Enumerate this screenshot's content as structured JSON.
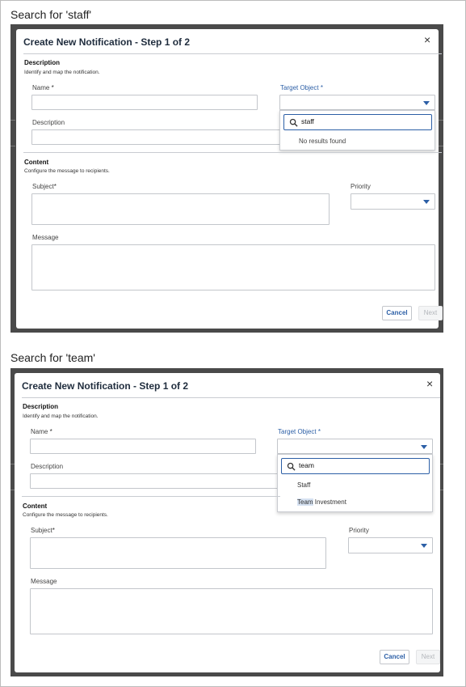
{
  "panels": [
    {
      "caption": "Search for 'staff'",
      "modal_title": "Create New Notification - Step 1 of 2",
      "close_glyph": "×",
      "description_section": {
        "title": "Description",
        "subtitle": "Identify and map the notification."
      },
      "name_label": "Name",
      "description_label": "Description",
      "target_object_label": "Target Object",
      "required_marker": "*",
      "search_value": "staff",
      "dropdown_message": "No results found",
      "content_section": {
        "title": "Content",
        "subtitle": "Configure the message to recipients."
      },
      "subject_label": "Subject",
      "priority_label": "Priority",
      "message_label": "Message",
      "cancel_label": "Cancel",
      "next_label": "Next"
    },
    {
      "caption": "Search for 'team'",
      "modal_title": "Create New Notification - Step 1 of 2",
      "close_glyph": "×",
      "description_section": {
        "title": "Description",
        "subtitle": "Identify and map the notification."
      },
      "name_label": "Name",
      "description_label": "Description",
      "target_object_label": "Target Object",
      "required_marker": "*",
      "search_value": "team",
      "dropdown_options": [
        {
          "label_highlight": "",
          "label_rest": "Staff"
        },
        {
          "label_highlight": "Team",
          "label_rest": " Investment"
        }
      ],
      "content_section": {
        "title": "Content",
        "subtitle": "Configure the message to recipients."
      },
      "subject_label": "Subject",
      "priority_label": "Priority",
      "message_label": "Message",
      "cancel_label": "Cancel",
      "next_label": "Next"
    }
  ],
  "colors": {
    "accent": "#2c5fa6",
    "frame": "#4a4a4a",
    "highlight": "#d6e2f2"
  },
  "icons": [
    "search-icon",
    "close-icon",
    "chevron-down-icon"
  ]
}
